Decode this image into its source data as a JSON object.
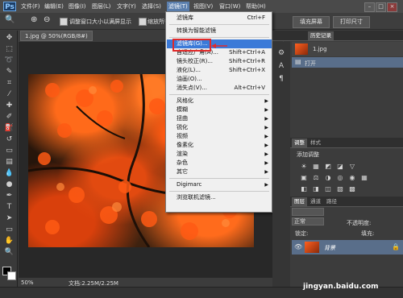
{
  "app": {
    "logo": "Ps"
  },
  "menubar": {
    "items": [
      "文件(F)",
      "编辑(E)",
      "图像(I)",
      "图层(L)",
      "文字(Y)",
      "选择(S)",
      "滤镜(T)",
      "视图(V)",
      "窗口(W)",
      "帮助(H)"
    ],
    "active_index": 6,
    "window_buttons": [
      "–",
      "□",
      "×"
    ]
  },
  "options": {
    "checkbox1_label": "调整窗口大小以满屏显示",
    "checkbox2_label": "缩放所有",
    "fill_screen_label": "填充屏幕",
    "print_size_label": "打印尺寸"
  },
  "document": {
    "tab_label": "1.jpg @ 50%(RGB/8#)",
    "zoom": "50%",
    "doc_size": "文档:2.25M/2.25M"
  },
  "filter_menu": {
    "items": [
      {
        "label": "滤镜库",
        "shortcut": "Ctrl+F"
      },
      {
        "sep": true
      },
      {
        "label": "转换为智能滤镜"
      },
      {
        "sep": true
      },
      {
        "label": "滤镜库(G)...",
        "highlight": true
      },
      {
        "label": "自适应广角(A)...",
        "shortcut": "Shift+Ctrl+A"
      },
      {
        "label": "镜头校正(R)...",
        "shortcut": "Shift+Ctrl+R"
      },
      {
        "label": "液化(L)...",
        "shortcut": "Shift+Ctrl+X"
      },
      {
        "label": "油画(O)..."
      },
      {
        "label": "消失点(V)...",
        "shortcut": "Alt+Ctrl+V"
      },
      {
        "sep": true
      },
      {
        "label": "风格化",
        "submenu": true
      },
      {
        "label": "模糊",
        "submenu": true
      },
      {
        "label": "扭曲",
        "submenu": true
      },
      {
        "label": "锐化",
        "submenu": true
      },
      {
        "label": "视频",
        "submenu": true
      },
      {
        "label": "像素化",
        "submenu": true
      },
      {
        "label": "渲染",
        "submenu": true
      },
      {
        "label": "杂色",
        "submenu": true
      },
      {
        "label": "其它",
        "submenu": true
      },
      {
        "sep": true
      },
      {
        "label": "Digimarc",
        "submenu": true
      },
      {
        "sep": true
      },
      {
        "label": "浏览联机滤镜..."
      }
    ]
  },
  "panels": {
    "history": {
      "tabs": [
        "历史记录"
      ],
      "snapshot_label": "1.jpg",
      "open_label": "打开"
    },
    "adjustments": {
      "tabs": [
        "调整",
        "样式"
      ],
      "title": "添加调整",
      "row1": [
        "☀",
        "▦",
        "◩",
        "◪",
        "▽"
      ],
      "row2": [
        "▣",
        "⚖",
        "◑",
        "◎",
        "◉",
        "▦"
      ],
      "row3": [
        "◧",
        "◨",
        "◫",
        "▧",
        "▩"
      ]
    },
    "layers": {
      "tabs": [
        "图层",
        "通道",
        "路径"
      ],
      "kind_label": "正常",
      "opacity_label": "不透明度:",
      "lock_label": "锁定:",
      "fill_label": "填充:",
      "layer_name": "背景"
    }
  },
  "watermark": "jingyan.baidu.com",
  "colors": {
    "accent": "#3b7ad8",
    "annotation": "#e02a2a"
  }
}
